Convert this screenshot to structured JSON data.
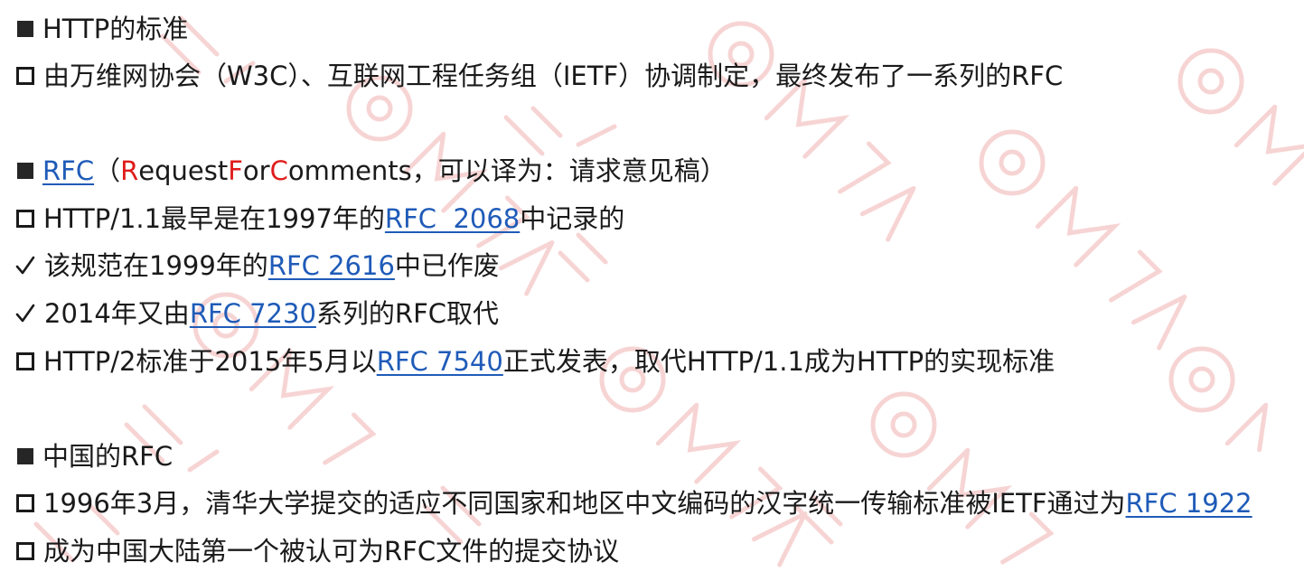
{
  "sections": {
    "http_standard": {
      "heading": "HTTP的标准",
      "item1": "由万维网协会（W3C）、互联网工程任务组（IETF）协调制定，最终发布了一系列的RFC"
    },
    "rfc": {
      "link": "RFC",
      "paren_open": "（",
      "r_letter": "R",
      "equest": "equest ",
      "f_letter": "F",
      "or": "or ",
      "c_letter": "C",
      "omments": "omments，可以译为：请求意见稿）",
      "http11_before": "HTTP/1.1最早是在1997年的",
      "http11_link": "RFC  2068",
      "http11_after": "中记录的",
      "obsolete_before": "该规范在1999年的",
      "obsolete_link": "RFC 2616",
      "obsolete_after": "中已作废",
      "replaced_before": "2014年又由",
      "replaced_link": "RFC 7230",
      "replaced_after": "系列的RFC取代",
      "http2_before": "HTTP/2标准于2015年5月以",
      "http2_link": "RFC 7540",
      "http2_after": "正式发表，取代HTTP/1.1成为HTTP的实现标准"
    },
    "china_rfc": {
      "heading": "中国的RFC",
      "item1_before": "1996年3月，清华大学提交的适应不同国家和地区中文编码的汉字统一传输标准被IETF通过为",
      "item1_link": "RFC 1922",
      "item2": "成为中国大陆第一个被认可为RFC文件的提交协议"
    }
  },
  "colors": {
    "link": "#1f5bb8",
    "highlight_letter": "#e01b1b",
    "watermark": "#f3c2c2"
  }
}
